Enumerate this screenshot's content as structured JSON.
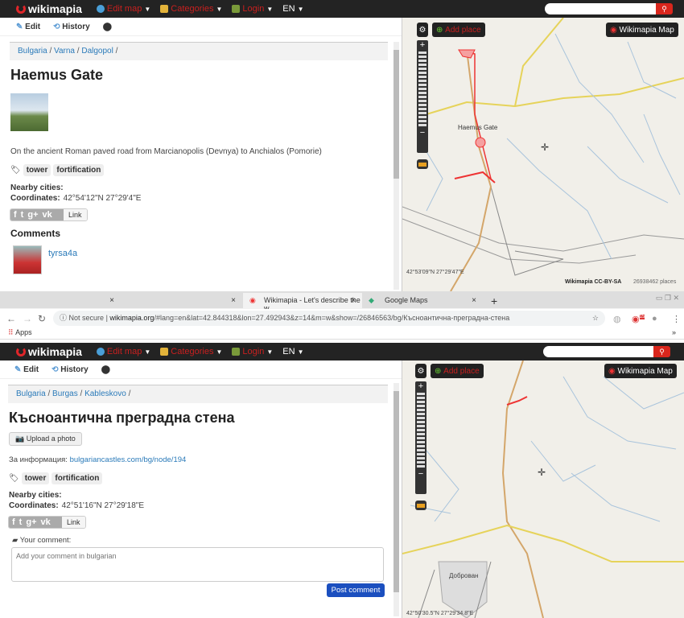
{
  "header": {
    "logo": "wikimapia",
    "edit_map": "Edit map",
    "categories": "Categories",
    "login": "Login",
    "lang": "EN",
    "search_icon": "search-icon"
  },
  "top": {
    "toolbar": {
      "edit": "Edit",
      "history": "History"
    },
    "breadcrumb": [
      "Bulgaria",
      "Varna",
      "Dalgopol"
    ],
    "title": "Haemus Gate",
    "description": "On the ancient Roman paved road from Marcianopolis (Devnya) to Anchialos (Pomorie)",
    "tags": [
      "tower",
      "fortification"
    ],
    "nearby_label": "Nearby cities:",
    "coords_label": "Coordinates:",
    "coords": "42°54'12\"N 27°29'4\"E",
    "share_link": "Link",
    "comments_heading": "Comments",
    "commenter": "tyrsa4a",
    "map": {
      "add_place": "Add place",
      "layer": "Wikimapia Map",
      "label": "Haemus Gate",
      "cursor_coords": "42°53'09\"N 27°29'47\"E",
      "license": "Wikimapia CC-BY-SA",
      "places": "26938462 places"
    }
  },
  "browser": {
    "tabs": [
      {
        "title": ""
      },
      {
        "title": ""
      },
      {
        "title": "Wikimapia - Let's describe the w"
      },
      {
        "title": "Google Maps"
      }
    ],
    "not_secure": "Not secure",
    "url_host": "wikimapia.org",
    "url_rest": "/#lang=en&lat=42.844318&lon=27.492943&z=14&m=w&show=/26846563/bg/Късноантична-преградна-стена",
    "badge": "15",
    "bookmarks": "Apps",
    "more": "»"
  },
  "bottom": {
    "toolbar": {
      "edit": "Edit",
      "history": "History"
    },
    "breadcrumb": [
      "Bulgaria",
      "Burgas",
      "Kableskovo"
    ],
    "title": "Късноантична преградна стена",
    "upload": "Upload a photo",
    "info_label": "За информация:",
    "info_link": "bulgariancastles.com/bg/node/194",
    "tags": [
      "tower",
      "fortification"
    ],
    "nearby_label": "Nearby cities:",
    "coords_label": "Coordinates:",
    "coords": "42°51'16\"N 27°29'18\"E",
    "share_link": "Link",
    "your_comment": "Your comment:",
    "comment_placeholder": "Add your comment in bulgarian",
    "post": "Post comment",
    "map": {
      "add_place": "Add place",
      "layer": "Wikimapia Map",
      "village": "Доброван",
      "cursor_coords": "42°50'30.5\"N 27°29'34.8\"E"
    }
  },
  "colors": {
    "accent": "#c8201f",
    "link": "#2a7ab9",
    "post": "#1b4fbf",
    "dark": "#232323"
  }
}
